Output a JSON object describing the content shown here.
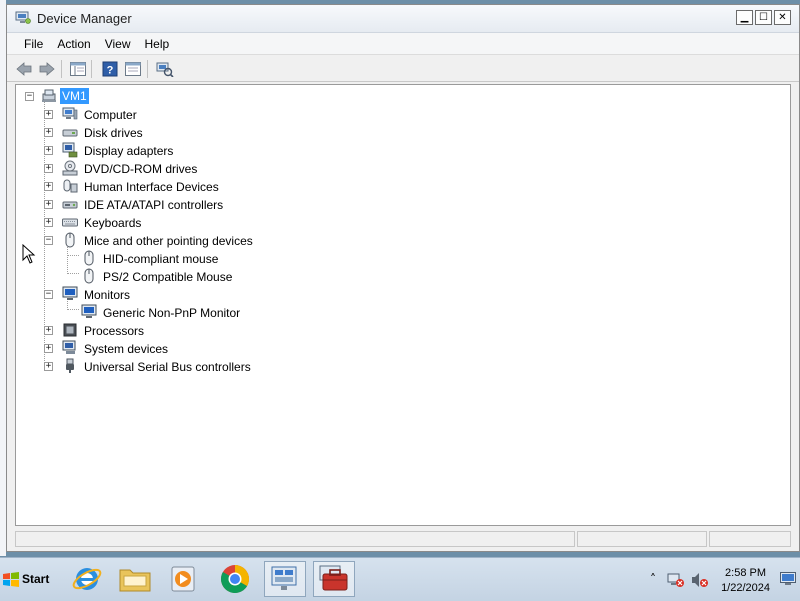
{
  "window": {
    "title": "Device Manager",
    "title_icon": "device-manager-icon"
  },
  "menu": [
    "File",
    "Action",
    "View",
    "Help"
  ],
  "toolbar_icons": [
    "back-icon",
    "forward-icon",
    "show-hide-console-tree-icon",
    "help-icon",
    "properties-icon",
    "scan-hardware-icon"
  ],
  "tree": {
    "root": "VM1",
    "categories": [
      {
        "label": "Computer",
        "icon": "computer-icon",
        "expanded": false
      },
      {
        "label": "Disk drives",
        "icon": "disk-drive-icon",
        "expanded": false
      },
      {
        "label": "Display adapters",
        "icon": "display-adapter-icon",
        "expanded": false
      },
      {
        "label": "DVD/CD-ROM drives",
        "icon": "dvd-drive-icon",
        "expanded": false
      },
      {
        "label": "Human Interface Devices",
        "icon": "hid-icon",
        "expanded": false
      },
      {
        "label": "IDE ATA/ATAPI controllers",
        "icon": "ide-controller-icon",
        "expanded": false
      },
      {
        "label": "Keyboards",
        "icon": "keyboard-icon",
        "expanded": false
      },
      {
        "label": "Mice and other pointing devices",
        "icon": "mouse-icon",
        "expanded": true,
        "children": [
          "HID-compliant mouse",
          "PS/2 Compatible Mouse"
        ]
      },
      {
        "label": "Monitors",
        "icon": "monitor-icon",
        "expanded": true,
        "children": [
          "Generic Non-PnP Monitor"
        ]
      },
      {
        "label": "Processors",
        "icon": "processor-icon",
        "expanded": false
      },
      {
        "label": "System devices",
        "icon": "system-devices-icon",
        "expanded": false
      },
      {
        "label": "Universal Serial Bus controllers",
        "icon": "usb-icon",
        "expanded": false
      }
    ]
  },
  "taskbar": {
    "start_label": "Start",
    "apps": [
      "internet-explorer-icon",
      "file-explorer-icon",
      "media-player-icon",
      "chrome-icon",
      "server-manager-icon",
      "toolbox-icon"
    ],
    "tray": {
      "time": "2:58 PM",
      "date": "1/22/2024"
    }
  },
  "colors": {
    "selection": "#3399ff",
    "taskbar": "#c8d6e5"
  }
}
